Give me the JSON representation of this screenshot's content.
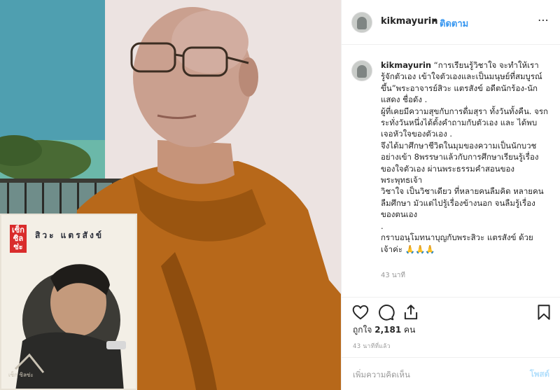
{
  "header": {
    "username": "kikmayurin",
    "separator": "•",
    "follow_label": "ติดตาม",
    "more_label": "⋯"
  },
  "caption": {
    "username": "kikmayurin",
    "text": " “การเรียนรู้วิชาใจ จะทำให้เรารู้จักตัวเอง เข้าใจตัวเองและเป็นมนุษย์ที่สมบูรณ์ขึ้น”พระอาจารย์สิวะ แตรสังข์ อดีตนักร้อง-นักแสดง ชื่อดัง .\nผู้ที่เคยมีความสุขกับการดื่มสุรา ทั้งวันทั้งคืน. จรกระทั่งวันหนึ่งได้ตั้งคำถามกับตัวเอง และ ได้พบเจอหัวใจของตัวเอง .\nจึงได้มาศึกษาชีวิตในมุมของความเป็นนักบวชอย่างเข้า 8พรรษาแล้วกับการศึกษาเรียนรู้เรื่องของใจตัวเอง ผ่านพระธรรมคำสอนของพระพุทธเจ้า\nวิชาใจ เป็นวิชาเดียว ที่หลายคนลืมคิด หลายคนลืมศึกษา มัวแต่ไปรู้เรื่องข้างนอก จนลืมรู้เรื่องของตนเอง\n.\nกราบอนุโมทนาบุญกับพระสิวะ แตรสังข์ ด้วยเจ้าค่ะ 🙏🙏🙏",
    "time": "43 นาที"
  },
  "inset": {
    "title": "เซ็ก ซิล ซ่ะ",
    "name": "สิวะ แตรสังข์",
    "logo": "เซ็ก ซิลซ่ะ"
  },
  "likes": {
    "prefix": "ถูกใจ",
    "count": "2,181",
    "suffix": "คน"
  },
  "post_time": "43 นาทีที่แล้ว",
  "comment": {
    "placeholder": "เพิ่มความคิดเห็น",
    "post_label": "โพสต์"
  },
  "colors": {
    "link_blue": "#3897f0",
    "post_disabled": "#b2dffc",
    "border": "#efefef",
    "robe": "#b7681a"
  },
  "icons": {
    "like": "heart-icon",
    "comment": "comment-icon",
    "share": "share-icon",
    "save": "bookmark-icon"
  }
}
